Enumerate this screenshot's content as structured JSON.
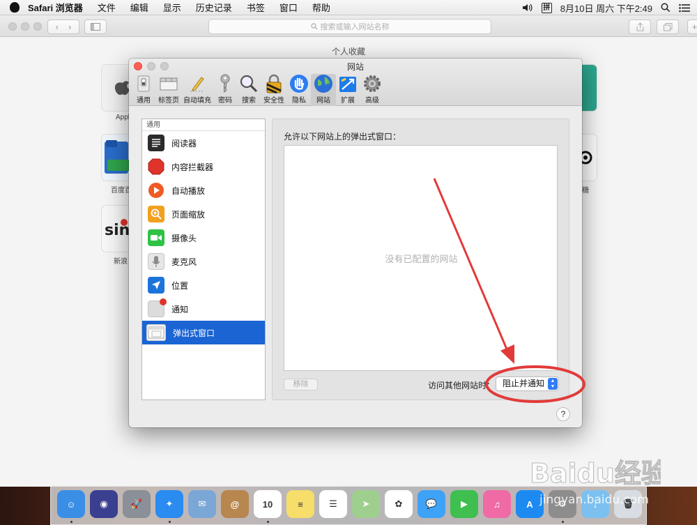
{
  "menubar": {
    "app": "Safari 浏览器",
    "items": [
      "文件",
      "编辑",
      "显示",
      "历史记录",
      "书签",
      "窗口",
      "帮助"
    ],
    "input_method": "拼",
    "clock": "8月10日 周六 下午2:49"
  },
  "safari": {
    "address_placeholder": "搜索或输入网站名称",
    "favorites_title": "个人收藏",
    "fav_labels": [
      "Appl",
      "百度百",
      "新浪",
      "糖"
    ]
  },
  "prefs": {
    "title": "网站",
    "tabs": [
      {
        "label": "通用",
        "icon": "general-switch-icon"
      },
      {
        "label": "标签页",
        "icon": "tabs-icon"
      },
      {
        "label": "自动填充",
        "icon": "autofill-pencil-icon"
      },
      {
        "label": "密码",
        "icon": "key-icon"
      },
      {
        "label": "搜索",
        "icon": "magnifier-icon"
      },
      {
        "label": "安全性",
        "icon": "lock-icon"
      },
      {
        "label": "隐私",
        "icon": "hand-icon"
      },
      {
        "label": "网站",
        "icon": "globe-icon"
      },
      {
        "label": "扩展",
        "icon": "puzzle-icon"
      },
      {
        "label": "高级",
        "icon": "gear-icon"
      }
    ],
    "active_tab": "网站",
    "sidebar": {
      "header": "通用",
      "items": [
        {
          "label": "阅读器",
          "icon": "reader-icon",
          "color": "#2b2b2b"
        },
        {
          "label": "内容拦截器",
          "icon": "stop-sign-icon",
          "color": "#e0332b"
        },
        {
          "label": "自动播放",
          "icon": "play-icon",
          "color": "#f05a24"
        },
        {
          "label": "页面缩放",
          "icon": "zoom-icon",
          "color": "#f2a01e"
        },
        {
          "label": "摄像头",
          "icon": "camera-icon",
          "color": "#2fc245"
        },
        {
          "label": "麦克风",
          "icon": "microphone-icon",
          "color": "#b5b5b5"
        },
        {
          "label": "位置",
          "icon": "location-arrow-icon",
          "color": "#1c74db"
        },
        {
          "label": "通知",
          "icon": "notification-icon",
          "color": "#d9d9d9"
        },
        {
          "label": "弹出式窗口",
          "icon": "popup-window-icon",
          "color": "#f4f4f4"
        }
      ],
      "selected": "弹出式窗口"
    },
    "content": {
      "title": "允许以下网站上的弹出式窗口：",
      "empty_text": "没有已配置的网站",
      "remove_button": "移除",
      "other_sites_label": "访问其他网站时：",
      "other_sites_value": "阻止并通知",
      "help": "?"
    }
  },
  "dock": {
    "apps": [
      {
        "name": "finder",
        "color": "#3a8ee6",
        "glyph": "☺"
      },
      {
        "name": "siri",
        "color": "#3a3f8f",
        "glyph": "◉"
      },
      {
        "name": "launchpad",
        "color": "#8a8f98",
        "glyph": "🚀"
      },
      {
        "name": "safari",
        "color": "#2a8bf0",
        "glyph": "✦"
      },
      {
        "name": "mail",
        "color": "#7ba7d6",
        "glyph": "✉"
      },
      {
        "name": "contacts",
        "color": "#b8864f",
        "glyph": "@"
      },
      {
        "name": "calendar",
        "color": "#ffffff",
        "glyph": "10"
      },
      {
        "name": "notes",
        "color": "#f7dd6a",
        "glyph": "≡"
      },
      {
        "name": "reminders",
        "color": "#ffffff",
        "glyph": "☰"
      },
      {
        "name": "maps",
        "color": "#9fcf8e",
        "glyph": "➤"
      },
      {
        "name": "photos",
        "color": "#ffffff",
        "glyph": "✿"
      },
      {
        "name": "messages",
        "color": "#3ea2f7",
        "glyph": "💬"
      },
      {
        "name": "facetime",
        "color": "#3fbf4f",
        "glyph": "▶"
      },
      {
        "name": "itunes",
        "color": "#f06aa5",
        "glyph": "♫"
      },
      {
        "name": "app-store",
        "color": "#1d8af2",
        "glyph": "A"
      },
      {
        "name": "system-preferences",
        "color": "#8d8d8d",
        "glyph": "⚙"
      },
      {
        "name": "downloads",
        "color": "#7cc0ef",
        "glyph": "↓"
      },
      {
        "name": "trash",
        "color": "#d8dde3",
        "glyph": "🗑"
      }
    ],
    "running": [
      "finder",
      "safari",
      "calendar",
      "system-preferences"
    ]
  },
  "watermark": "Baidu经验 jingyan.baidu.com"
}
